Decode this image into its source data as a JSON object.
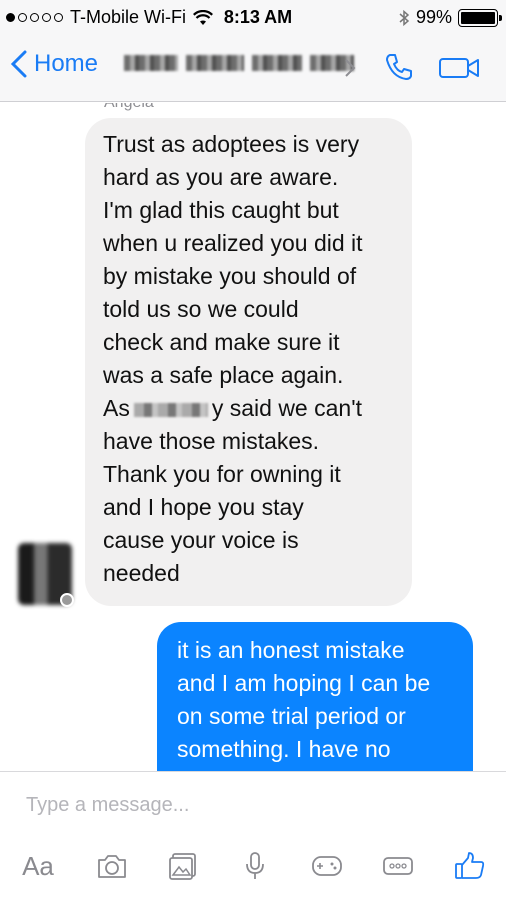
{
  "status_bar": {
    "carrier": "T-Mobile Wi-Fi",
    "time": "8:13 AM",
    "battery": "99%",
    "battery_level": 0.99,
    "signal_bars_filled": 1,
    "signal_bars_total": 5
  },
  "nav": {
    "back_label": "Home",
    "icons": [
      "chevron-left-icon",
      "chevron-right-icon",
      "phone-icon",
      "video-camera-icon"
    ]
  },
  "thread": {
    "sender_label": "Angela",
    "incoming_lines": [
      "Trust as adoptees is very",
      "hard as you are aware.",
      "I'm glad this caught but",
      "when u realized you did it",
      "by mistake you should of",
      "told us so we could",
      "check and make sure it",
      "was a safe place again."
    ],
    "incoming_line_as_before": "As",
    "incoming_line_as_after": "y said we can't",
    "incoming_lines_end": [
      "have those mistakes.",
      "Thank you for owning it",
      "and I hope you stay",
      "cause your voice is",
      "needed"
    ],
    "outgoing_lines": [
      "it is an honest mistake",
      "and I am hoping I can be",
      "on some trial period or",
      "something. I have no"
    ]
  },
  "composer": {
    "placeholder": "Type a message...",
    "aa_label": "Aa",
    "tool_icons": [
      "camera-icon",
      "photo-icon",
      "microphone-icon",
      "game-controller-icon",
      "more-icon",
      "thumbs-up-icon"
    ]
  },
  "colors": {
    "accent": "#1a7cf5",
    "outgoing_bubble": "#0b84ff",
    "incoming_bubble": "#f1f0f0",
    "muted": "#8e8e93"
  }
}
